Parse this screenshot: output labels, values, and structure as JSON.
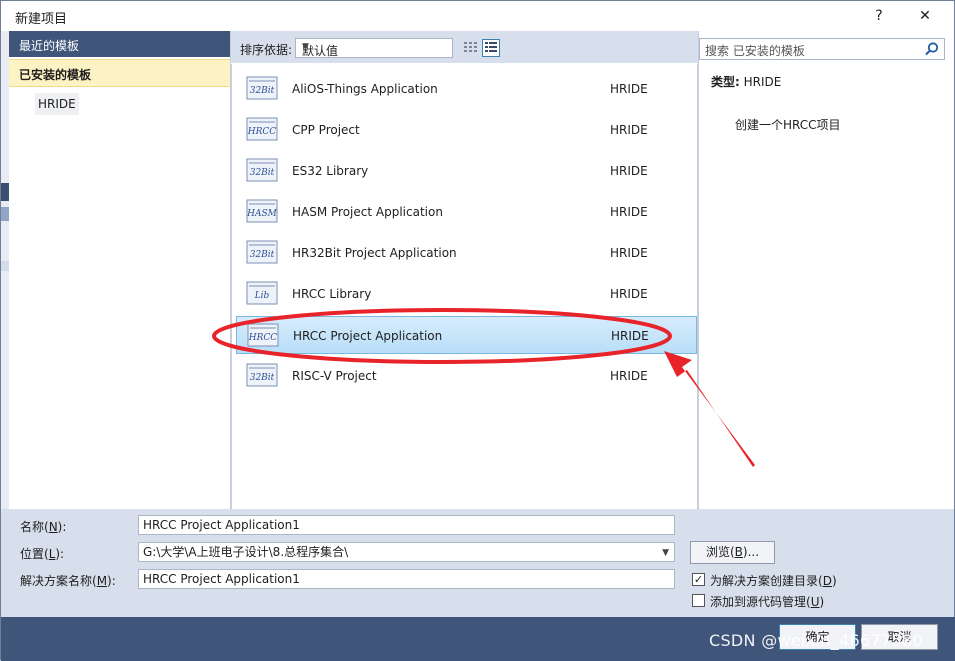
{
  "window": {
    "title": "新建项目",
    "help_glyph": "?",
    "close_glyph": "✕"
  },
  "sidebar": {
    "recent_label": "最近的模板",
    "installed_label": "已安装的模板",
    "items": [
      {
        "label": "HRIDE"
      }
    ]
  },
  "toolbar": {
    "sort_label": "排序依据:",
    "sort_value": "默认值"
  },
  "templates": [
    {
      "icon": "32Bit",
      "name": "AliOS-Things Application",
      "lang": "HRIDE"
    },
    {
      "icon": "HRCC",
      "name": "CPP Project",
      "lang": "HRIDE"
    },
    {
      "icon": "32Bit",
      "name": "ES32 Library",
      "lang": "HRIDE"
    },
    {
      "icon": "HASM",
      "name": "HASM Project Application",
      "lang": "HRIDE"
    },
    {
      "icon": "32Bit",
      "name": "HR32Bit Project Application",
      "lang": "HRIDE"
    },
    {
      "icon": "Lib",
      "name": "HRCC Library",
      "lang": "HRIDE"
    },
    {
      "icon": "HRCC",
      "name": "HRCC Project Application",
      "lang": "HRIDE",
      "selected": true
    },
    {
      "icon": "32Bit",
      "name": "RISC-V Project",
      "lang": "HRIDE"
    }
  ],
  "details": {
    "search_placeholder": "搜索 已安装的模板",
    "type_label": "类型:",
    "type_value": "HRIDE",
    "description": "创建一个HRCC项目"
  },
  "form": {
    "name_label": "名称(",
    "name_key": "N",
    "name_suffix": "):",
    "name_value": "HRCC Project Application1",
    "location_label": "位置(",
    "location_key": "L",
    "location_suffix": "):",
    "location_value": "G:\\大学\\A上班电子设计\\8.总程序集合\\",
    "browse_label": "浏览(",
    "browse_key": "B",
    "browse_suffix": ")...",
    "solution_label": "解决方案名称(",
    "solution_key": "M",
    "solution_suffix": "):",
    "solution_value": "HRCC Project Application1",
    "create_dir_label": "为解决方案创建目录(",
    "create_dir_key": "D",
    "create_dir_suffix": ")",
    "create_dir_checked": true,
    "add_source_label": "添加到源代码管理(",
    "add_source_key": "U",
    "add_source_suffix": ")",
    "add_source_checked": false
  },
  "buttons": {
    "ok": "确定",
    "cancel": "取消"
  },
  "watermark": "CSDN @weixin_46677580",
  "colors": {
    "header": "#3f567a",
    "selection": "#b8def8",
    "annotation": "#e8232a"
  }
}
